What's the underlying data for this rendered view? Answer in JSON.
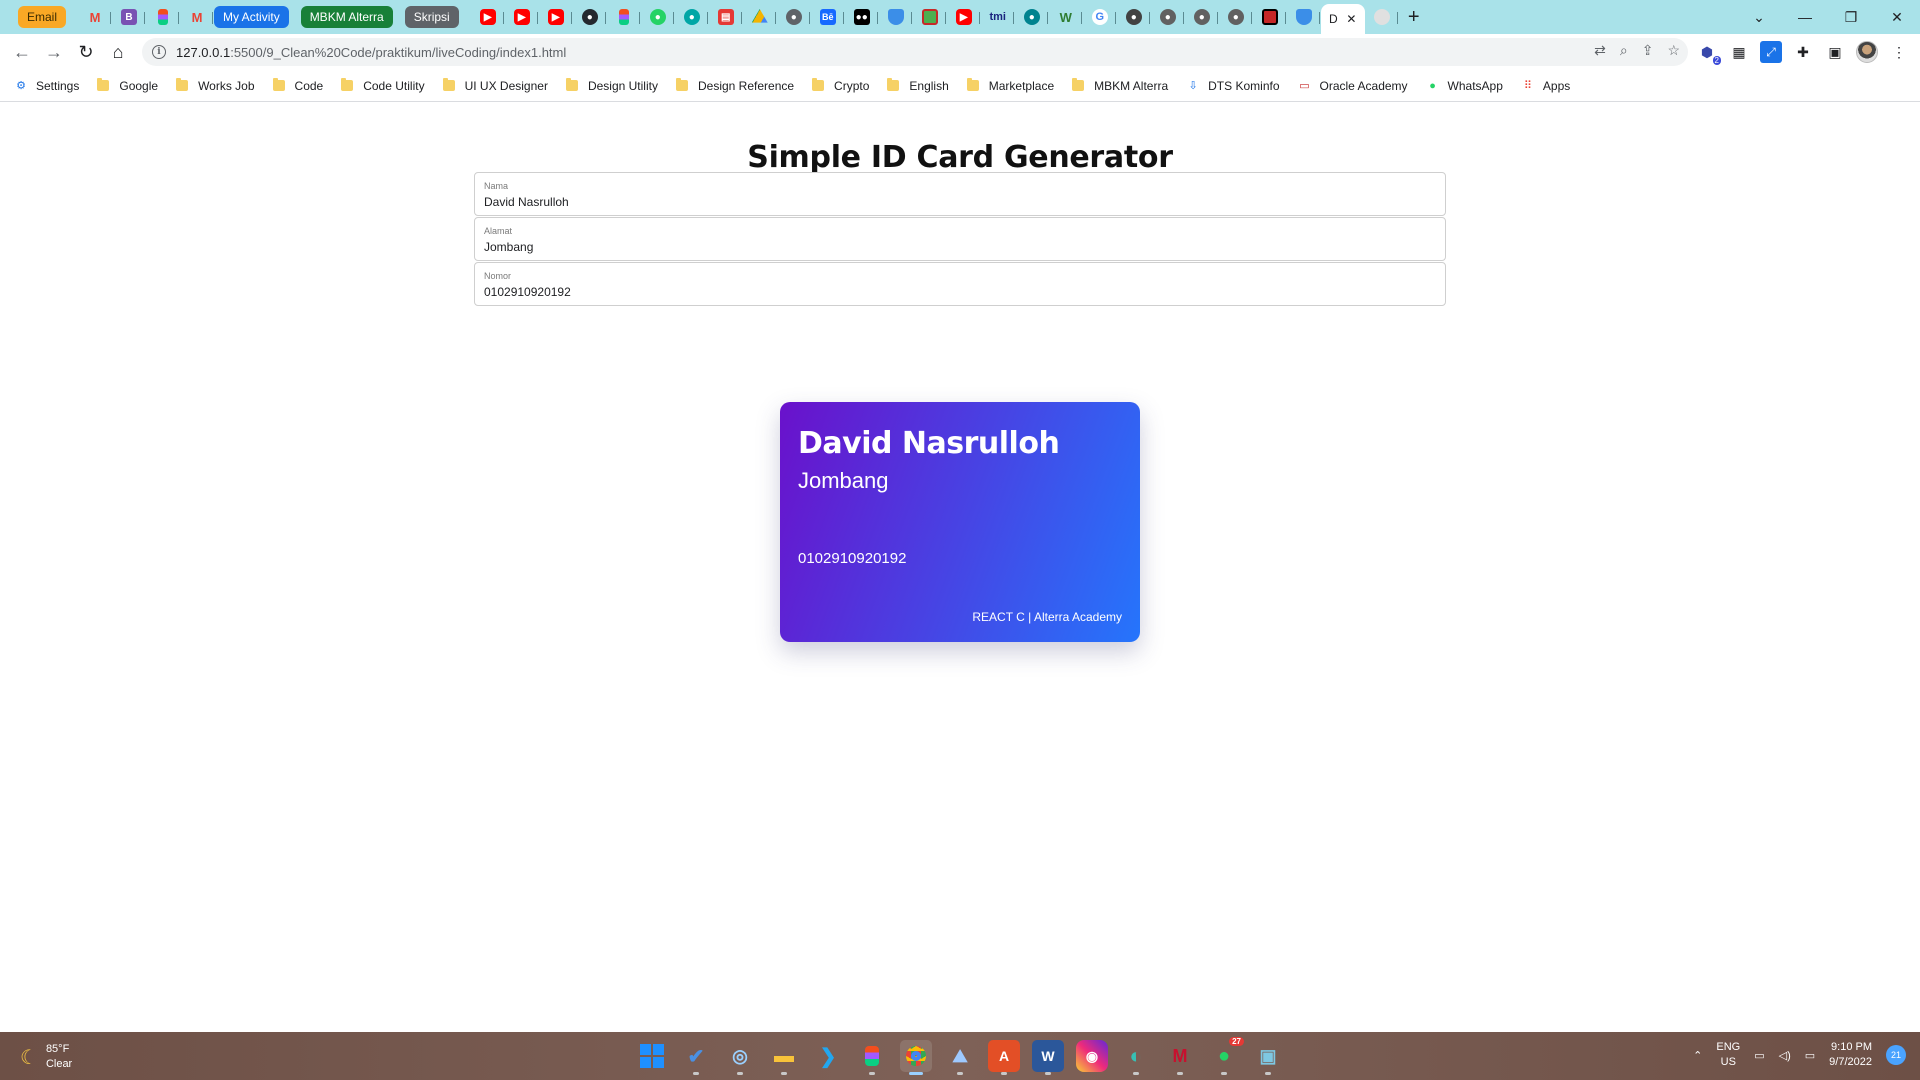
{
  "browser": {
    "tabs": {
      "pills": [
        {
          "label": "Email",
          "color": "orange"
        },
        {
          "label": "My Activity",
          "color": "blue"
        },
        {
          "label": "MBKM Alterra",
          "color": "green"
        },
        {
          "label": "Skripsi",
          "color": "grey"
        }
      ],
      "favicons": [
        "gmail-icon",
        "bootstrap-icon",
        "figma-icon",
        "gmail-icon",
        "youtube-icon",
        "youtube-icon",
        "youtube-icon",
        "github-icon",
        "figma-icon",
        "chat-icon",
        "globe-icon",
        "pdf-icon",
        "drive-icon",
        "globe-icon",
        "behance-icon",
        "medium-icon",
        "shield-icon",
        "app-icon",
        "youtube-icon",
        "tmi-icon",
        "globe-icon",
        "w-icon",
        "google-icon",
        "globe-icon",
        "globe-icon",
        "globe-icon",
        "globe-icon",
        "app-icon",
        "shield-icon"
      ],
      "active_tab_letter": "D",
      "close_glyph": "✕",
      "new_tab_glyph": "+"
    },
    "address": {
      "host": "127.0.0.1",
      "path": ":5500/9_Clean%20Code/praktikum/liveCoding/index1.html"
    },
    "bookmarks": [
      {
        "label": "Settings",
        "icon": "gear-icon"
      },
      {
        "label": "Google",
        "icon": "folder-icon"
      },
      {
        "label": "Works Job",
        "icon": "folder-icon"
      },
      {
        "label": "Code",
        "icon": "folder-icon"
      },
      {
        "label": "Code Utility",
        "icon": "folder-icon"
      },
      {
        "label": "UI UX Designer",
        "icon": "folder-icon"
      },
      {
        "label": "Design Utility",
        "icon": "folder-icon"
      },
      {
        "label": "Design Reference",
        "icon": "folder-icon"
      },
      {
        "label": "Crypto",
        "icon": "folder-icon"
      },
      {
        "label": "English",
        "icon": "folder-icon"
      },
      {
        "label": "Marketplace",
        "icon": "folder-icon"
      },
      {
        "label": "MBKM Alterra",
        "icon": "folder-icon"
      },
      {
        "label": "DTS Kominfo",
        "icon": "dts-icon"
      },
      {
        "label": "Oracle Academy",
        "icon": "oracle-icon"
      },
      {
        "label": "WhatsApp",
        "icon": "whatsapp-icon"
      },
      {
        "label": "Apps",
        "icon": "apps-grid-icon"
      }
    ],
    "extension_badge": "2"
  },
  "page": {
    "title": "Simple ID Card Generator",
    "fields": [
      {
        "label": "Nama",
        "value": "David Nasrulloh"
      },
      {
        "label": "Alamat",
        "value": "Jombang"
      },
      {
        "label": "Nomor",
        "value": "0102910920192"
      }
    ],
    "card": {
      "name": "David Nasrulloh",
      "address": "Jombang",
      "number": "0102910920192",
      "footer": "REACT C | Alterra Academy",
      "gradient_start": "#6a11cb",
      "gradient_end": "#2575fc"
    }
  },
  "taskbar": {
    "weather": {
      "temp": "85°F",
      "condition": "Clear"
    },
    "apps": [
      "windows-start-icon",
      "todo-icon",
      "cortana-icon",
      "file-explorer-icon",
      "vscode-icon",
      "figma-icon",
      "chrome-icon",
      "photos-icon",
      "acrobat-icon",
      "word-icon",
      "instagram-icon",
      "edge-icon",
      "mendeley-icon",
      "whatsapp-icon",
      "gallery-icon"
    ],
    "whatsapp_badge": "27",
    "language": {
      "line1": "ENG",
      "line2": "US"
    },
    "clock": {
      "time": "9:10 PM",
      "date": "9/7/2022"
    },
    "notification_count": "21"
  }
}
